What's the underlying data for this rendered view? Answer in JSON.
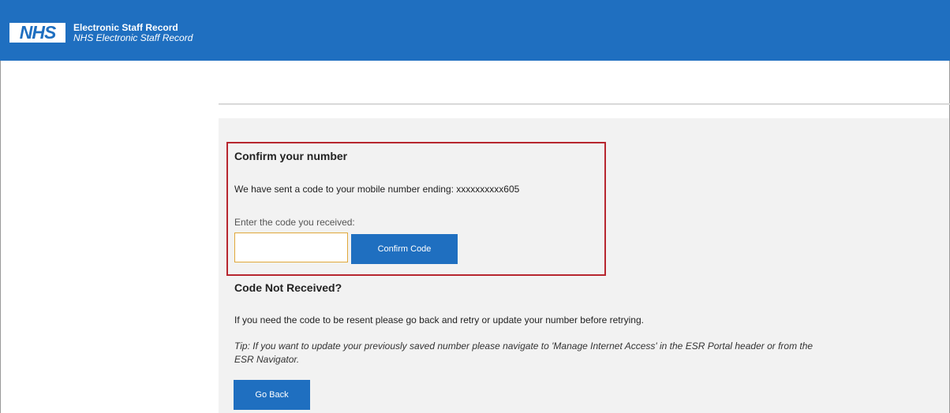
{
  "header": {
    "logo_text": "NHS",
    "title": "Electronic Staff Record",
    "subtitle": "NHS Electronic Staff Record"
  },
  "confirm": {
    "title": "Confirm your number",
    "message": "We have sent a code to your mobile number ending: xxxxxxxxxx605",
    "code_label": "Enter the code you received:",
    "code_value": "",
    "button_label": "Confirm Code"
  },
  "not_received": {
    "title": "Code Not Received?",
    "message": "If you need the code to be resent please go back and retry or update your number before retrying.",
    "tip": "Tip: If you want to update your previously saved number please navigate to 'Manage Internet Access' in the ESR Portal header or from the ESR Navigator.",
    "back_button_label": "Go Back"
  },
  "colors": {
    "header_bg": "#1f6fc0",
    "button_bg": "#1f6fc0",
    "highlight_border": "#b7262f",
    "input_border": "#e0a83a",
    "panel_bg": "#f2f2f2"
  }
}
